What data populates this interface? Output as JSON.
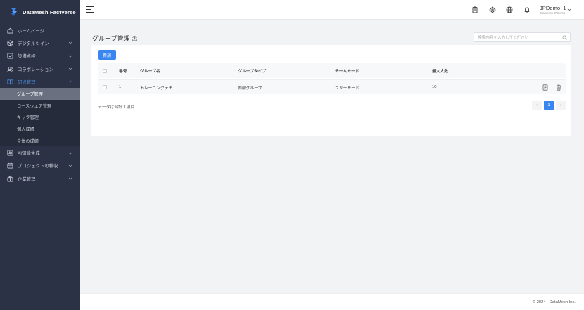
{
  "app": {
    "name": "DataMesh FactVerse"
  },
  "sidebar": {
    "items": [
      {
        "label": "ホームページ",
        "icon": "home-icon",
        "expandable": false
      },
      {
        "label": "デジタルツイン",
        "icon": "cube-icon",
        "expandable": true
      },
      {
        "label": "設備点検",
        "icon": "checklist-icon",
        "expandable": true
      },
      {
        "label": "コラボレーション",
        "icon": "users-icon",
        "expandable": true
      },
      {
        "label": "研修管理",
        "icon": "book-icon",
        "expandable": true,
        "open": true
      }
    ],
    "subitems": [
      {
        "label": "グループ管理",
        "active": true
      },
      {
        "label": "コースウェア管理"
      },
      {
        "label": "キャラ管理"
      },
      {
        "label": "個人成績"
      },
      {
        "label": "全体の成績"
      }
    ],
    "items_after": [
      {
        "label": "AI知能生成",
        "icon": "ai-icon",
        "expandable": true
      },
      {
        "label": "プロジェクトの検収",
        "icon": "calendar-icon",
        "expandable": true
      },
      {
        "label": "企業管理",
        "icon": "briefcase-icon",
        "expandable": true
      }
    ]
  },
  "header": {
    "icons": [
      "clipboard-icon",
      "diamond-icon",
      "globe-icon",
      "bell-icon"
    ],
    "user": {
      "name": "JPDemo_1",
      "role": "Datamesh JPDemo"
    }
  },
  "page": {
    "title": "グループ管理",
    "search_placeholder": "検索内容を入力してください",
    "new_button": "新規",
    "columns": [
      "番号",
      "グループ名",
      "グループタイプ",
      "チームモード",
      "最大人数"
    ],
    "rows": [
      {
        "no": "1",
        "name": "トレーニングデモ",
        "type": "内部グループ",
        "mode": "フリーモード",
        "max": "10"
      }
    ],
    "total_text": "データは合計１項目",
    "pagination": {
      "current": "1",
      "prev": "‹",
      "next": "›"
    }
  },
  "footer": {
    "copyright": "© 2024 - DataMesh Inc."
  },
  "colors": {
    "accent": "#3a86f0",
    "sidebar_bg": "#2b3245",
    "active_sub": "#6a7080"
  }
}
